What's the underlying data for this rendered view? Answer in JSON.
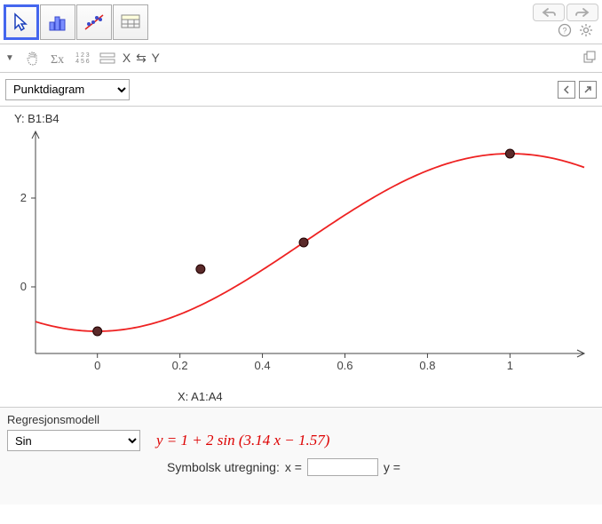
{
  "toolbar": {
    "tools": [
      "pointer",
      "bar-chart",
      "scatter-fit",
      "table"
    ],
    "selected": 0
  },
  "sub_toolbar": {
    "xy_label": "X ⇆ Y"
  },
  "chart_type_select": {
    "value": "Punktdiagram"
  },
  "chart_data": {
    "type": "scatter",
    "title": "",
    "x_label": "X:  A1:A4",
    "y_label": "Y:  B1:B4",
    "x": [
      0,
      0.25,
      0.5,
      1
    ],
    "y": [
      -1,
      0.4,
      1,
      3
    ],
    "curve": {
      "label": "y = 1 + 2 sin(3.14 x − 1.57)",
      "formula": "1 + 2*sin(3.14*x - 1.57)"
    },
    "x_ticks": [
      0,
      0.2,
      0.4,
      0.6,
      0.8,
      1
    ],
    "y_ticks": [
      0,
      2
    ],
    "xlim": [
      -0.15,
      1.18
    ],
    "ylim": [
      -1.5,
      3.5
    ]
  },
  "regression": {
    "panel_title": "Regresjonsmodell",
    "model_select": "Sin",
    "equation": "y = 1 + 2  sin (3.14 x − 1.57)",
    "eval_label": "Symbolsk utregning:",
    "x_prefix": "x =",
    "x_value": "",
    "y_prefix": "y ="
  }
}
